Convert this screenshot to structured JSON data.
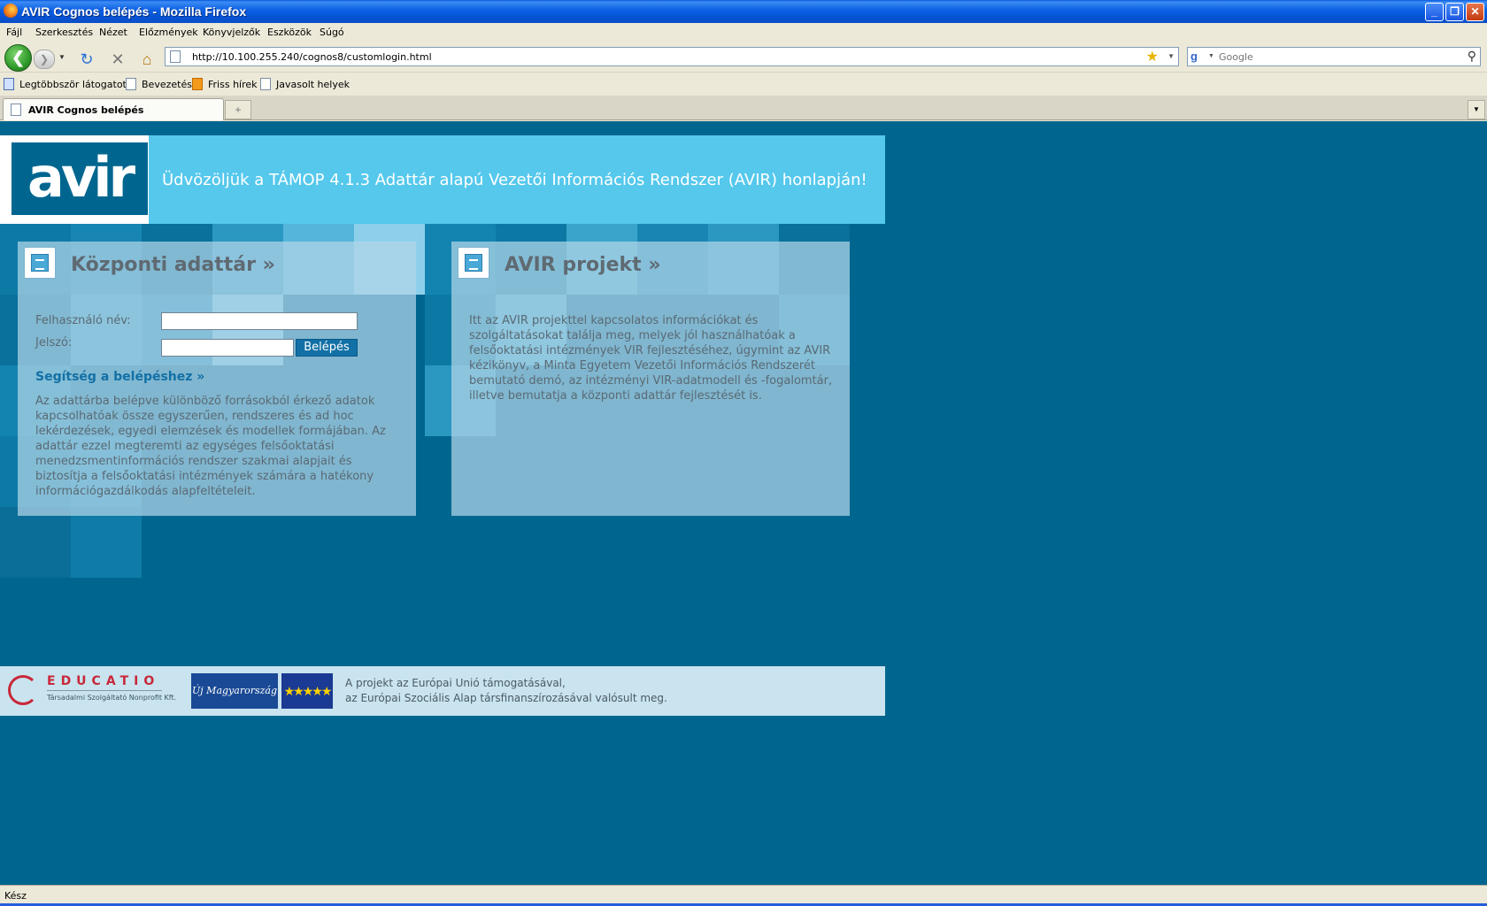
{
  "window": {
    "title": "AVIR Cognos belépés - Mozilla Firefox",
    "minimize_glyph": "_",
    "restore_glyph": "❐",
    "close_glyph": "✕"
  },
  "menu": [
    "Fájl",
    "Szerkesztés",
    "Nézet",
    "Előzmények",
    "Könyvjelzők",
    "Eszközök",
    "Súgó"
  ],
  "nav": {
    "back_glyph": "❮",
    "forward_glyph": "❯",
    "reload_glyph": "↻",
    "stop_glyph": "✕",
    "home_glyph": "⌂",
    "url": "http://10.100.255.240/cognos8/customlogin.html",
    "search_placeholder": "Google",
    "search_engine_glyph": "g"
  },
  "bookmarks": [
    "Legtöbbször látogatott",
    "Bevezetés",
    "Friss hírek",
    "Javasolt helyek"
  ],
  "tabs": [
    {
      "label": "AVIR Cognos belépés"
    }
  ],
  "page": {
    "logo_text": "avir",
    "welcome": "Üdvözöljük a TÁMOP 4.1.3 Adattár alapú Vezetői Információs Rendszer (AVIR) honlapján!",
    "left_panel": {
      "title": "Központi adattár »",
      "username_label": "Felhasználó név:",
      "password_label": "Jelszó:",
      "username_value": "",
      "password_value": "",
      "login_button": "Belépés",
      "help_link": "Segítség a belépéshez »",
      "description": "Az adattárba belépve különböző forrásokból érkező adatok kapcsolhatóak össze egyszerűen, rendszeres és ad hoc lekérdezések, egyedi elemzések és modellek formájában. Az adattár ezzel megteremti az egységes felsőoktatási menedzsmentinformációs rendszer szakmai alapjait és biztosítja a felsőoktatási intézmények számára a hatékony információgazdálkodás alapfeltételeit."
    },
    "right_panel": {
      "title": "AVIR projekt »",
      "description": "Itt az AVIR projekttel kapcsolatos információkat és szolgáltatásokat találja meg, melyek jól használhatóak a felsőoktatási intézmények VIR fejlesztéséhez, úgymint az AVIR kézikönyv, a Minta Egyetem Vezetői Információs Rendszerét bemutató demó, az intézményi VIR-adatmodell és -fogalomtár, illetve bemutatja a központi adattár fejlesztését is."
    },
    "footer": {
      "educatio_name": "EDUCATIO",
      "educatio_sub": "Társadalmi Szolgáltató Nonprofit Kft.",
      "umft_label": "Új Magyarország",
      "eu_stars": "★★★★★",
      "text_line1": "A projekt az Európai Unió támogatásával,",
      "text_line2": "az Európai Szociális Alap társfinanszírozásával valósult meg."
    }
  },
  "status": "Kész",
  "colors": {
    "page_bg": "#00668f",
    "header_bg": "#55c8ec",
    "button_bg": "#1270a6",
    "footer_bg": "#c9e4ef"
  }
}
